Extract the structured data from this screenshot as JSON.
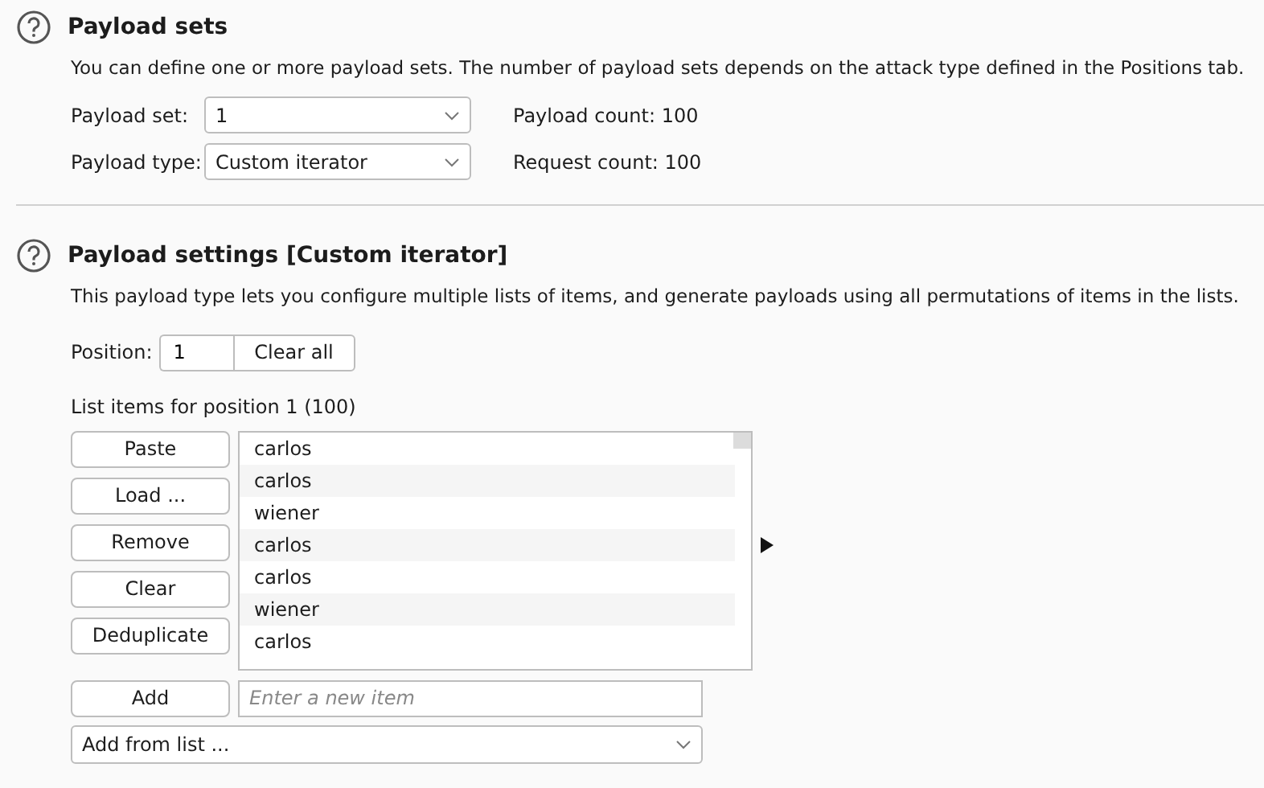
{
  "sections": [
    {
      "title": "Payload sets",
      "description": "You can define one or more payload sets. The number of payload sets depends on the attack type defined in the Positions tab.",
      "fields": [
        {
          "label": "Payload set:",
          "value": "1",
          "count": "Payload count: 100"
        },
        {
          "label": "Payload type:",
          "value": "Custom iterator",
          "count": "Request count: 100"
        }
      ]
    },
    {
      "title": "Payload settings [Custom iterator]",
      "description": "This payload type lets you configure multiple lists of items, and generate payloads using all permutations of items in the lists.",
      "position": {
        "label": "Position:",
        "value": "1",
        "button": "Clear all"
      },
      "list_label": "List items for position 1 (100)",
      "list_buttons": [
        "Paste",
        "Load ...",
        "Remove",
        "Clear",
        "Deduplicate"
      ],
      "items": [
        "carlos",
        "carlos",
        "wiener",
        "carlos",
        "carlos",
        "wiener",
        "carlos"
      ],
      "add_button": "Add",
      "add_field": {
        "placeholder": "Enter a new item"
      },
      "add_from_list": "Add from list ..."
    }
  ]
}
